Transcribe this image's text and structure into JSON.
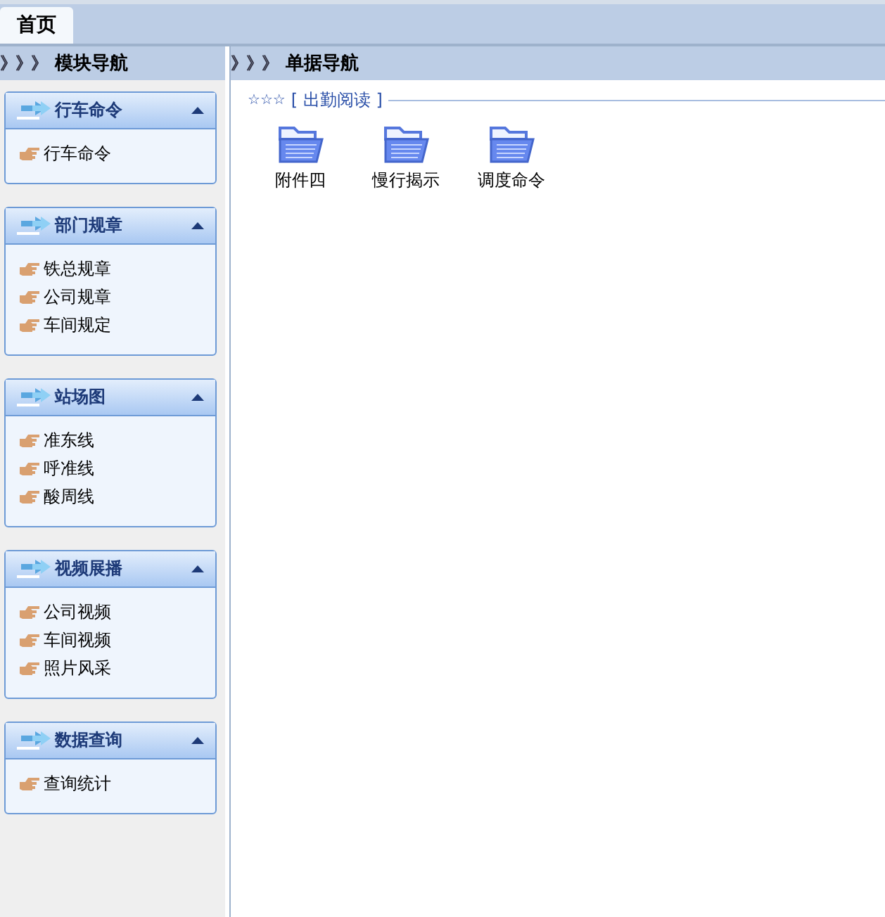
{
  "tabs": [
    {
      "label": "首页",
      "selected": true
    }
  ],
  "sidebar": {
    "prefix": "》》》",
    "title": "模块导航",
    "panels": [
      {
        "title": "行车命令",
        "expanded": true,
        "items": [
          "行车命令"
        ]
      },
      {
        "title": "部门规章",
        "expanded": true,
        "items": [
          "铁总规章",
          "公司规章",
          "车间规定"
        ]
      },
      {
        "title": "站场图",
        "expanded": true,
        "items": [
          "准东线",
          "呼准线",
          "酸周线"
        ]
      },
      {
        "title": "视频展播",
        "expanded": true,
        "items": [
          "公司视频",
          "车间视频",
          "照片风采"
        ]
      },
      {
        "title": "数据查询",
        "expanded": true,
        "items": [
          "查询统计"
        ]
      }
    ]
  },
  "main": {
    "prefix": "》》》",
    "title": "单据导航",
    "group": {
      "stars": "☆☆☆",
      "title": "[ 出勤阅读 ]",
      "folders": [
        "附件四",
        "慢行揭示",
        "调度命令"
      ]
    }
  }
}
